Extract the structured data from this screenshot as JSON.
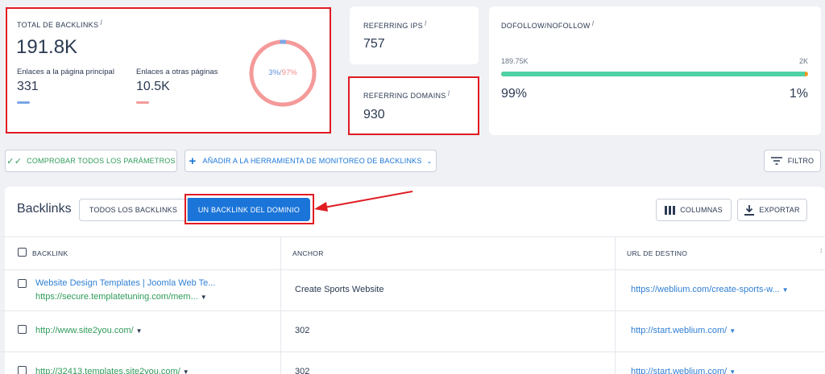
{
  "summary": {
    "total_backlinks_label": "TOTAL DE BACKLINKS",
    "total_backlinks_value": "191.8K",
    "main_page_label": "Enlaces a la página principal",
    "main_page_value": "331",
    "other_pages_label": "Enlaces a otras páginas",
    "other_pages_value": "10.5K",
    "donut_blue_text": "3%",
    "donut_sep": "/",
    "donut_red_text": "97%",
    "donut_blue_fraction": 0.03,
    "info_mark": "i"
  },
  "referring_ips": {
    "label": "REFERRING IPS",
    "value": "757"
  },
  "referring_domains": {
    "label": "REFERRING DOMAINS",
    "value": "930"
  },
  "dofollow": {
    "label": "DOFOLLOW/NOFOLLOW",
    "left_count": "189.75K",
    "right_count": "2K",
    "left_pct": "99%",
    "right_pct": "1%",
    "dofollow_fraction": 0.99
  },
  "toolbar": {
    "check_all": "COMPROBAR TODOS LOS PARÁMETROS",
    "add_monitor": "AÑADIR A LA HERRAMIENTA DE MONITOREO DE BACKLINKS",
    "filter": "FILTRO"
  },
  "section": {
    "title": "Backlinks",
    "tab_all": "TODOS LOS BACKLINKS",
    "tab_one": "UN BACKLINK DEL DOMINIO",
    "columns": "COLUMNAS",
    "export": "EXPORTAR"
  },
  "table": {
    "headers": [
      "BACKLINK",
      "ANCHOR",
      "URL DE DESTINO"
    ],
    "rows": [
      {
        "title": "Website Design Templates | Joomla Web Te...",
        "url": "https://secure.templatetuning.com/mem...",
        "anchor": "Create Sports Website",
        "dest": "https://weblium.com/create-sports-w..."
      },
      {
        "title": "",
        "url": "http://www.site2you.com/",
        "anchor": "302",
        "dest": "http://start.weblium.com/"
      },
      {
        "title": "",
        "url": "http://32413.templates.site2you.com/",
        "anchor": "302",
        "dest": "http://start.weblium.com/"
      }
    ]
  },
  "colors": {
    "accent": "#1b75d9",
    "donut_red": "#f49a9a",
    "donut_blue": "#7aa7e6",
    "bar_green": "#4fd1a5",
    "bar_orange": "#f59a1e",
    "annotation_red": "#e01b22"
  }
}
